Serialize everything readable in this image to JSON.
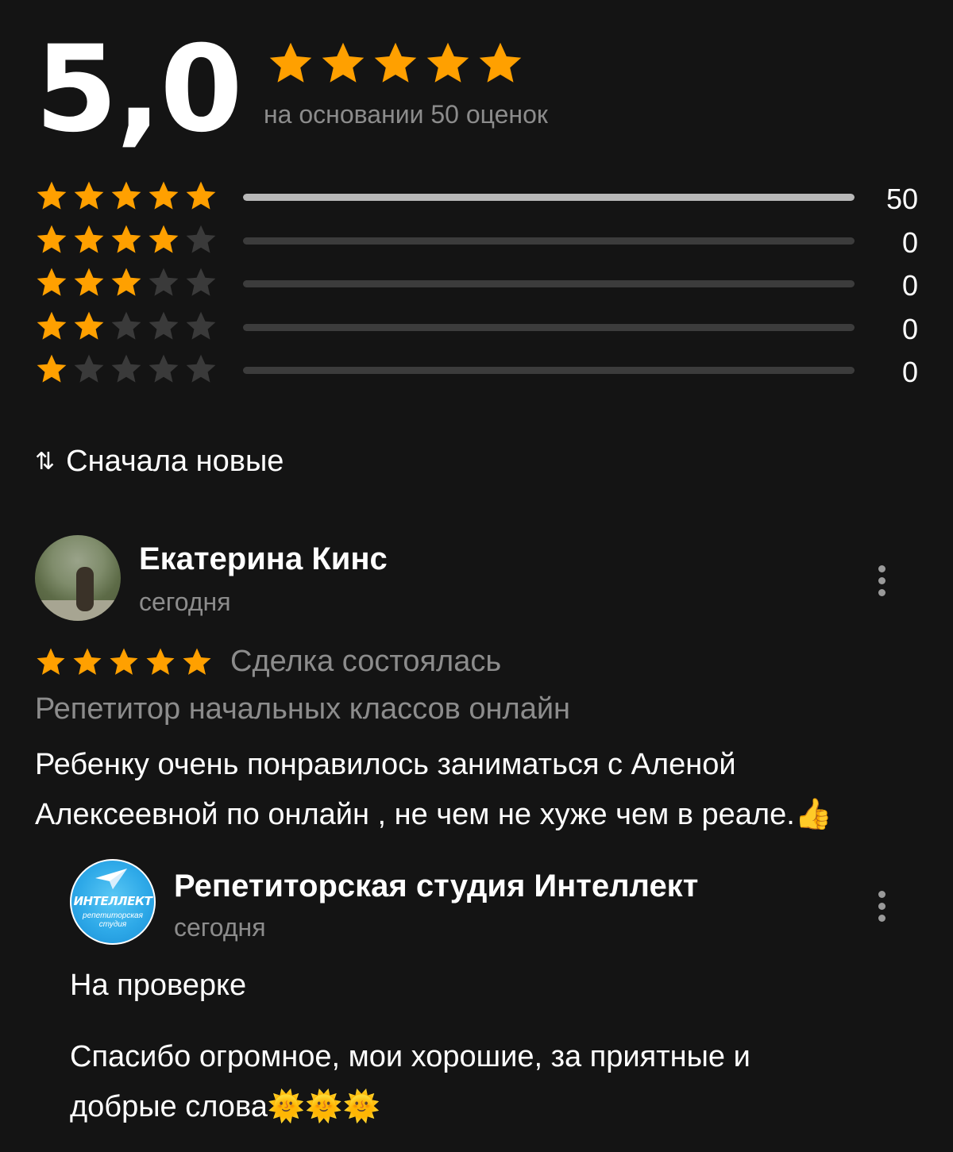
{
  "summary": {
    "average": "5,0",
    "stars": 5,
    "based_on": "на основании 50 оценок"
  },
  "distribution": [
    {
      "stars": 5,
      "count": "50",
      "fraction": 1.0
    },
    {
      "stars": 4,
      "count": "0",
      "fraction": 0
    },
    {
      "stars": 3,
      "count": "0",
      "fraction": 0
    },
    {
      "stars": 2,
      "count": "0",
      "fraction": 0
    },
    {
      "stars": 1,
      "count": "0",
      "fraction": 0
    }
  ],
  "sort": {
    "icon": "sort-arrows-icon",
    "label": "Сначала новые"
  },
  "review": {
    "author": "Екатерина Кинс",
    "date": "сегодня",
    "rating": 5,
    "deal_status": "Сделка состоялась",
    "service": "Репетитор начальных классов онлайн",
    "text": "Ребенку очень понравилось заниматься  с Аленой Алексеевной  по онлайн , не чем не хуже чем в реале.",
    "text_emoji": "👍"
  },
  "reply": {
    "author": "Репетиторская студия Интеллект",
    "date": "сегодня",
    "logo_text": "ИНТЕЛЛЕКТ",
    "logo_sub": "репетиторская студия",
    "status": "На проверке",
    "text": "Спасибо огромное, мои хорошие, за приятные и добрые слова",
    "text_emoji": "🌞🌞🌞"
  },
  "colors": {
    "background": "#141414",
    "star_filled": "#FFA000",
    "star_empty": "#3a3a3a",
    "muted_text": "#8c8c8c",
    "bar_fill": "#b8b8b8",
    "bar_track": "#3c3c3c"
  }
}
